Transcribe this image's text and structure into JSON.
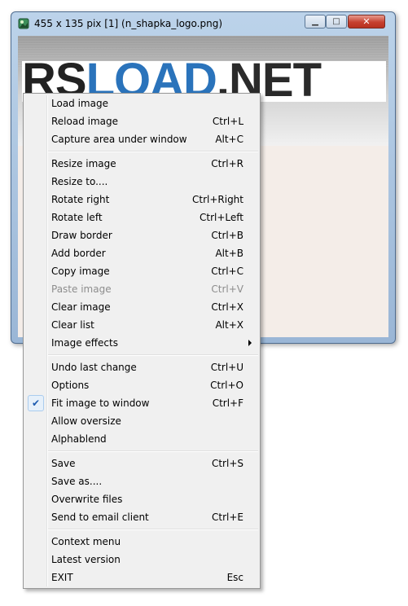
{
  "window": {
    "title": "455 x 135 pix [1] (n_shapka_logo.png)",
    "controls": {
      "minimize_icon": "minimize-icon",
      "maximize_icon": "maximize-icon",
      "close_icon": "close-icon"
    }
  },
  "image": {
    "logo_part1": "RS",
    "logo_part2": "LOAD",
    "logo_part3": ".NET"
  },
  "menu": {
    "groups": [
      [
        {
          "label": "Load image",
          "shortcut": ""
        },
        {
          "label": "Reload image",
          "shortcut": "Ctrl+L"
        },
        {
          "label": "Capture area under window",
          "shortcut": "Alt+C"
        }
      ],
      [
        {
          "label": "Resize image",
          "shortcut": "Ctrl+R"
        },
        {
          "label": "Resize to....",
          "shortcut": ""
        },
        {
          "label": "Rotate right",
          "shortcut": "Ctrl+Right"
        },
        {
          "label": "Rotate left",
          "shortcut": "Ctrl+Left"
        },
        {
          "label": "Draw border",
          "shortcut": "Ctrl+B"
        },
        {
          "label": "Add border",
          "shortcut": "Alt+B"
        },
        {
          "label": "Copy image",
          "shortcut": "Ctrl+C"
        },
        {
          "label": "Paste image",
          "shortcut": "Ctrl+V",
          "disabled": true
        },
        {
          "label": "Clear image",
          "shortcut": "Ctrl+X"
        },
        {
          "label": "Clear list",
          "shortcut": "Alt+X"
        },
        {
          "label": "Image effects",
          "shortcut": "",
          "submenu": true
        }
      ],
      [
        {
          "label": "Undo last change",
          "shortcut": "Ctrl+U"
        },
        {
          "label": "Options",
          "shortcut": "Ctrl+O"
        },
        {
          "label": "Fit image to window",
          "shortcut": "Ctrl+F",
          "checked": true
        },
        {
          "label": "Allow oversize",
          "shortcut": ""
        },
        {
          "label": "Alphablend",
          "shortcut": ""
        }
      ],
      [
        {
          "label": "Save",
          "shortcut": "Ctrl+S"
        },
        {
          "label": "Save as....",
          "shortcut": ""
        },
        {
          "label": "Overwrite files",
          "shortcut": ""
        },
        {
          "label": "Send to email client",
          "shortcut": "Ctrl+E"
        }
      ],
      [
        {
          "label": "Context menu",
          "shortcut": ""
        },
        {
          "label": "Latest version",
          "shortcut": ""
        },
        {
          "label": "EXIT",
          "shortcut": "Esc"
        }
      ]
    ]
  }
}
